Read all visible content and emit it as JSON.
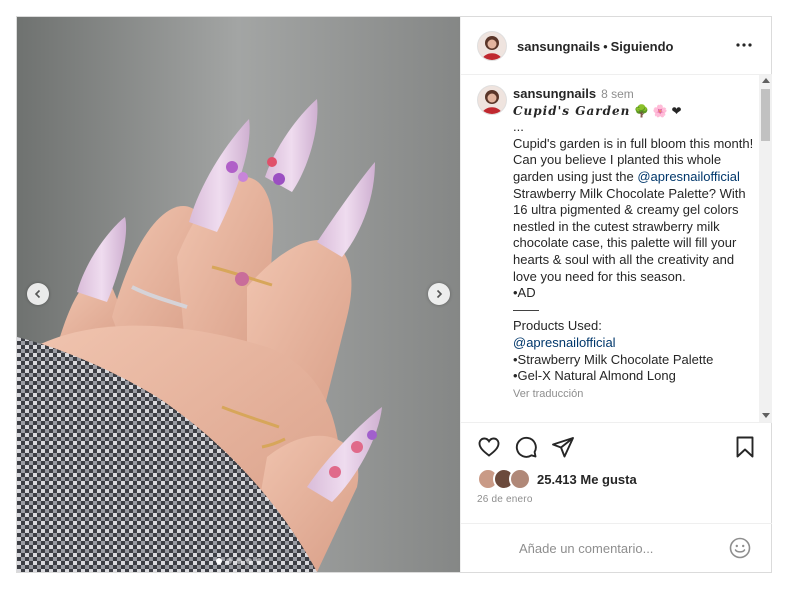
{
  "post": {
    "username": "sansungnails",
    "follow_status": "Siguiendo",
    "more_icon": "more-horizontal-icon",
    "carousel": {
      "slide_count": 5,
      "active_slide": 1
    }
  },
  "caption": {
    "username": "sansungnails",
    "time_ago": "8 sem",
    "title": "𝑪𝒖𝒑𝒊𝒅'𝒔 𝑮𝒂𝒓𝒅𝒆𝒏",
    "title_emojis": "🌳 🌸 ❤",
    "ellipsis": "...",
    "body_before_link": "Cupid's garden is in full bloom this month! Can you believe I planted this whole garden using just the",
    "mention": "@apresnailofficial",
    "body_after_link": "Strawberry Milk Chocolate Palette? With 16 ultra pigmented & creamy gel colors nestled in the cutest strawberry milk chocolate case, this palette will fill your hearts & soul with all the creativity and love you need for this season.",
    "ad_tag": "•AD",
    "divider": "——",
    "products_heading": "Products Used:",
    "products_mention": "@apresnailofficial",
    "product_1": "•Strawberry Milk Chocolate Palette",
    "product_2": "•Gel-X Natural Almond Long",
    "translate": "Ver traducción"
  },
  "actions": {
    "like_icon": "heart-icon",
    "comment_icon": "comment-icon",
    "share_icon": "share-icon",
    "save_icon": "bookmark-icon",
    "likes_text": "25.413 Me gusta",
    "date": "26 de enero"
  },
  "comment": {
    "placeholder": "Añade un comentario...",
    "emoji_icon": "smiley-icon"
  },
  "colors": {
    "link": "#00376b",
    "secondary_text": "#8e8e8e",
    "border": "#efefef",
    "nail_lilac": "#e3c9e4"
  }
}
